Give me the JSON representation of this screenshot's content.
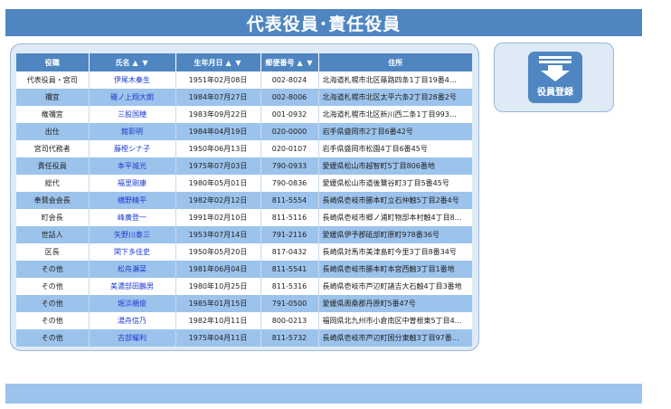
{
  "header": {
    "title": "代表役員･責任役員"
  },
  "register": {
    "label": "役員登録"
  },
  "table": {
    "columns": [
      {
        "label": "役職",
        "sort": ""
      },
      {
        "label": "氏名",
        "sort": "▲ ▼"
      },
      {
        "label": "生年月日",
        "sort": "▲ ▼"
      },
      {
        "label": "郵便番号",
        "sort": "▲ ▼"
      },
      {
        "label": "住所",
        "sort": ""
      }
    ],
    "rows": [
      {
        "role": "代表役員・宮司",
        "name": "伊尾木秦生",
        "dob": "1951年02月08日",
        "zip": "002-8024",
        "address": "北海道札幌市北区篠路四条1丁目19番4…"
      },
      {
        "role": "禰宜",
        "name": "磯ノ上翔大朗",
        "dob": "1984年07月27日",
        "zip": "002-8006",
        "address": "北海道札幌市北区太平六条2丁目28番2号"
      },
      {
        "role": "権禰宜",
        "name": "三股国穂",
        "dob": "1983年09月22日",
        "zip": "001-0932",
        "address": "北海道札幌市北区新川西二条1丁目993…"
      },
      {
        "role": "出仕",
        "name": "館彰明",
        "dob": "1984年04月19日",
        "zip": "020-0000",
        "address": "岩手県盛岡市2丁目6番42号"
      },
      {
        "role": "宮司代務者",
        "name": "藤樫シナ子",
        "dob": "1950年06月13日",
        "zip": "020-0107",
        "address": "岩手県盛岡市松園4丁目6番45号"
      },
      {
        "role": "責任役員",
        "name": "本平城光",
        "dob": "1975年07月03日",
        "zip": "790-0933",
        "address": "愛媛県松山市越智町5丁目806番地"
      },
      {
        "role": "総代",
        "name": "福里剛康",
        "dob": "1980年05月01日",
        "zip": "790-0836",
        "address": "愛媛県松山市道後鷺谷町3丁目5番45号"
      },
      {
        "role": "奉賛会会長",
        "name": "横野精平",
        "dob": "1982年02月12日",
        "zip": "811-5554",
        "address": "長崎県壱岐市勝本町立石仲触5丁目2番4号"
      },
      {
        "role": "町会長",
        "name": "峰廣登一",
        "dob": "1991年02月10日",
        "zip": "811-5116",
        "address": "長崎県壱岐市郷ノ浦町物部本村触4丁目8…"
      },
      {
        "role": "世話人",
        "name": "矢野川泰三",
        "dob": "1953年07月14日",
        "zip": "791-2116",
        "address": "愛媛県伊予郡砥部町原町978番36号"
      },
      {
        "role": "区長",
        "name": "閑下多佳史",
        "dob": "1950年05月20日",
        "zip": "817-0432",
        "address": "長崎県対馬市美津島町今里3丁目8番34号"
      },
      {
        "role": "その他",
        "name": "松舟瀬菜",
        "dob": "1981年06月04日",
        "zip": "811-5541",
        "address": "長崎県壱岐市勝本町本宮西触3丁目1番地"
      },
      {
        "role": "その他",
        "name": "美濃部田鵬男",
        "dob": "1980年10月25日",
        "zip": "811-5316",
        "address": "長崎県壱岐市芦辺町諸吉大石触4丁目3番地"
      },
      {
        "role": "その他",
        "name": "堀浜親俊",
        "dob": "1985年01月15日",
        "zip": "791-0500",
        "address": "愛媛県周桑郡丹原町5番47号"
      },
      {
        "role": "その他",
        "name": "湯舟信乃",
        "dob": "1982年10月11日",
        "zip": "800-0213",
        "address": "福岡県北九州市小倉南区中曽根東5丁目4…"
      },
      {
        "role": "その他",
        "name": "古部耀利",
        "dob": "1975年04月11日",
        "zip": "811-5732",
        "address": "長崎県壱岐市芦辺町国分東触3丁目97番…"
      }
    ]
  },
  "colors": {
    "header": "#4f86c1",
    "row_alt": "#9cc3ec",
    "name_link": "#1a3bd1",
    "panel": "#dfeaf7"
  }
}
